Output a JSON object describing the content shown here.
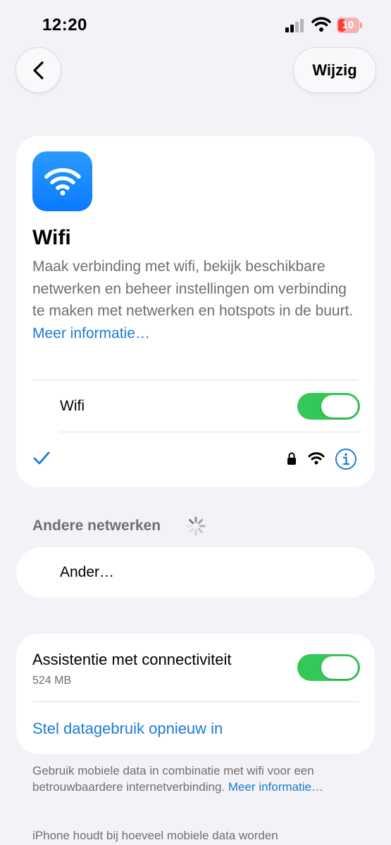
{
  "status": {
    "time": "12:20",
    "battery": "10"
  },
  "nav": {
    "edit_label": "Wijzig"
  },
  "wifi_card": {
    "title": "Wifi",
    "description": "Maak verbinding met wifi, bekijk beschikbare netwerken en beheer instellingen om verbinding te maken met netwerken en hotspots in de buurt.",
    "more_link": "Meer informatie…",
    "toggle_label": "Wifi",
    "toggle_on": true,
    "connected_network": ""
  },
  "other_networks": {
    "header": "Andere netwerken",
    "other_label": "Ander…"
  },
  "assist_card": {
    "label": "Assistentie met connectiviteit",
    "usage": "524 MB",
    "toggle_on": true,
    "reset_link": "Stel datagebruik opnieuw in"
  },
  "footer": {
    "text": "Gebruik mobiele data in combinatie met wifi voor een betrouwbaardere internetverbinding.",
    "more_link": "Meer informatie…",
    "text2": "iPhone houdt bij hoeveel mobiele data worden"
  },
  "colors": {
    "accent": "#1a7bd6",
    "toggle_on": "#34c759",
    "background": "#f2f2f7"
  }
}
